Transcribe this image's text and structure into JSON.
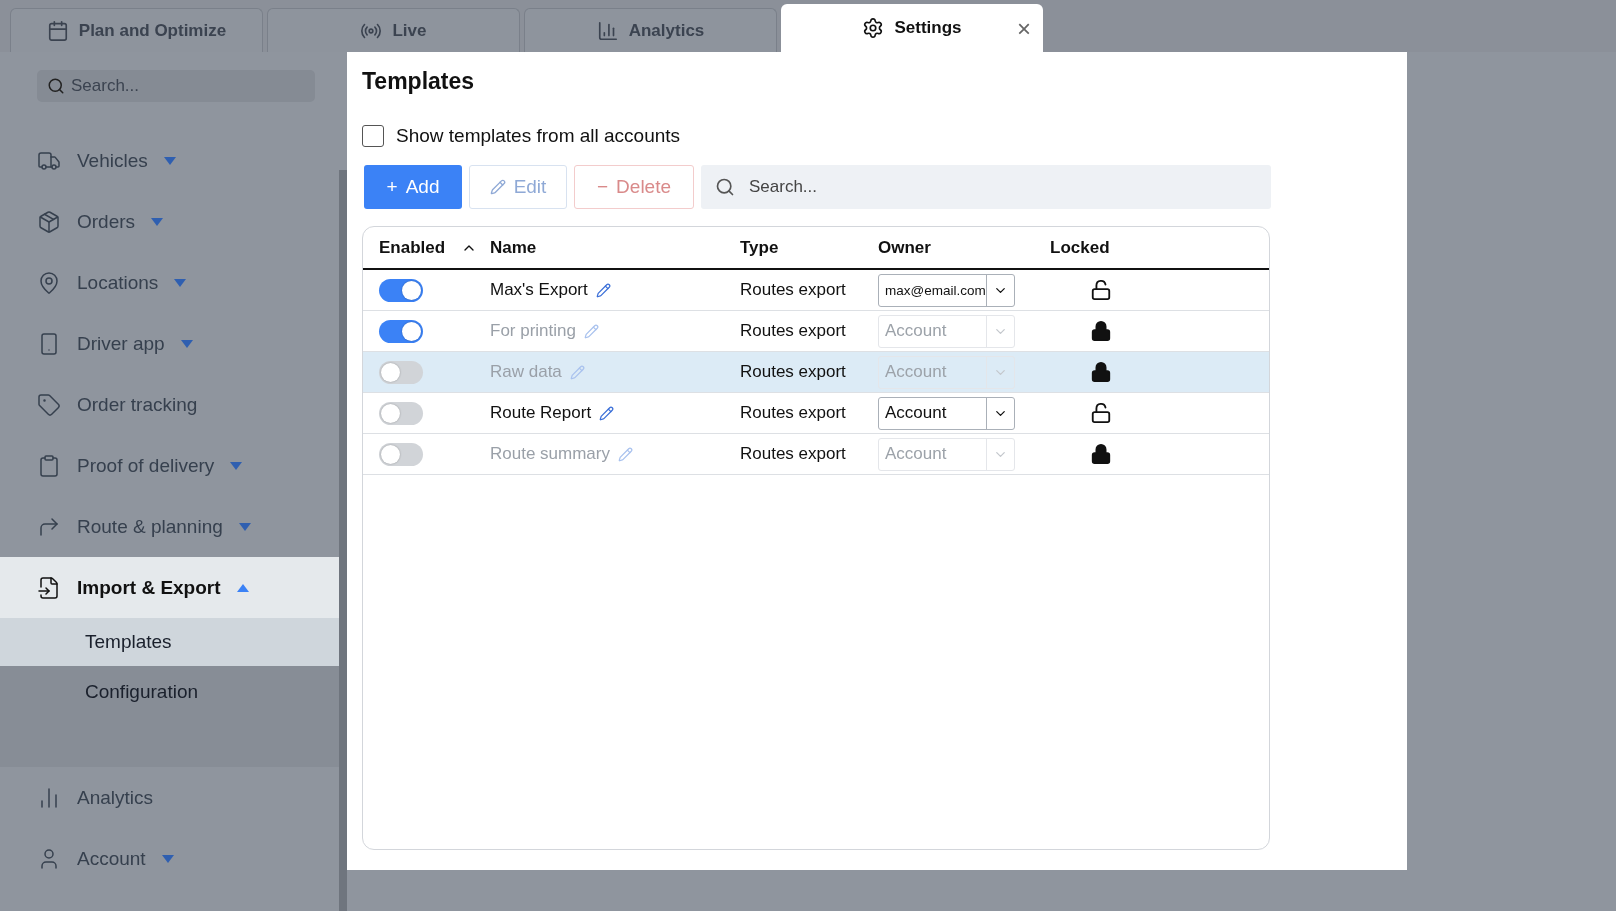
{
  "tabs": [
    {
      "label": "Plan and Optimize",
      "selected": false
    },
    {
      "label": "Live",
      "selected": false
    },
    {
      "label": "Analytics",
      "selected": false
    },
    {
      "label": "Settings",
      "selected": true,
      "close": "×"
    }
  ],
  "sidebar": {
    "search": {
      "placeholder": "Search..."
    },
    "items": [
      {
        "label": "Vehicles",
        "expanded": false
      },
      {
        "label": "Orders",
        "expanded": false
      },
      {
        "label": "Locations",
        "expanded": false
      },
      {
        "label": "Driver app",
        "expanded": false
      },
      {
        "label": "Order tracking"
      },
      {
        "label": "Proof of delivery",
        "expanded": false
      },
      {
        "label": "Route & planning",
        "expanded": false
      },
      {
        "label": "Import & Export",
        "expanded": true,
        "children": [
          {
            "label": "Templates",
            "selected": true
          },
          {
            "label": "Configuration",
            "selected": false
          }
        ]
      },
      {
        "label": "Analytics"
      },
      {
        "label": "Account",
        "expanded": false
      }
    ]
  },
  "panel": {
    "title": "Templates",
    "show_all": {
      "label": "Show templates from all accounts",
      "checked": false
    },
    "buttons": [
      {
        "kind": "add",
        "label": "Add",
        "symbol": "+",
        "disabled": false
      },
      {
        "kind": "edit",
        "label": "Edit",
        "disabled": true
      },
      {
        "kind": "delete",
        "label": "Delete",
        "symbol": "−",
        "disabled": true
      }
    ],
    "search": {
      "placeholder": "Search..."
    },
    "table": {
      "columns": [
        {
          "label": "Enabled",
          "sorted": true
        },
        {
          "label": "Name"
        },
        {
          "label": "Type"
        },
        {
          "label": "Owner"
        },
        {
          "label": "Locked"
        }
      ],
      "rows": [
        {
          "enabled": true,
          "name": "Max's Export",
          "type": "Routes export",
          "owner": "max@email.com",
          "locked": false,
          "selected": false
        },
        {
          "enabled": true,
          "name": "For printing",
          "type": "Routes export",
          "owner": "Account",
          "locked": true,
          "selected": false
        },
        {
          "enabled": false,
          "name": "Raw data",
          "type": "Routes export",
          "owner": "Account",
          "locked": true,
          "selected": true
        },
        {
          "enabled": false,
          "name": "Route Report",
          "type": "Routes export",
          "owner": "Account",
          "locked": false,
          "selected": false
        },
        {
          "enabled": false,
          "name": "Route summary",
          "type": "Routes export",
          "owner": "Account",
          "locked": true,
          "selected": false
        }
      ]
    }
  }
}
